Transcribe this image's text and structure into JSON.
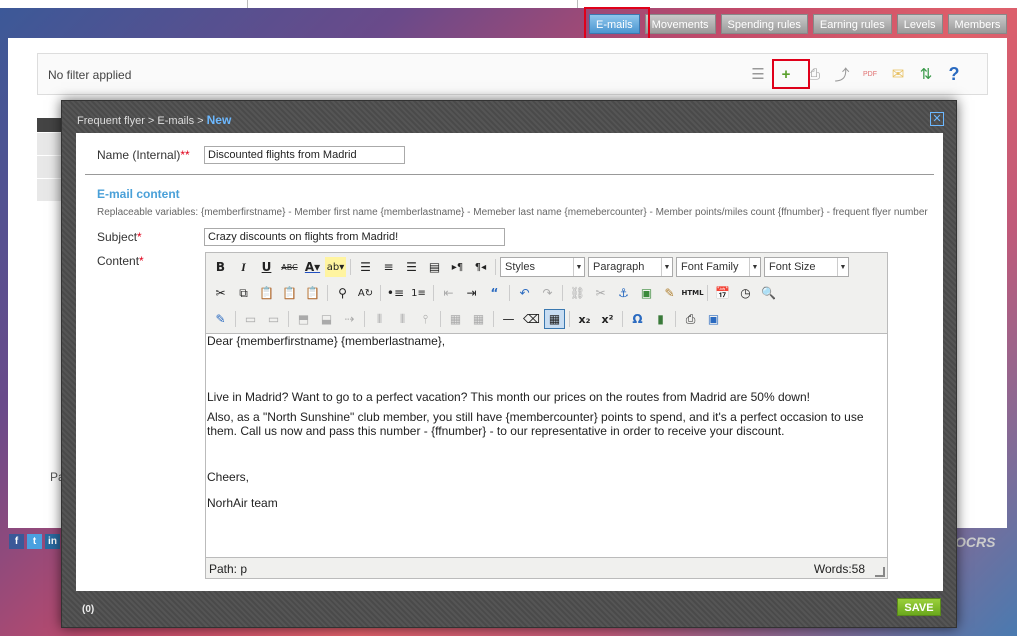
{
  "nav": {
    "tabs": [
      "E-mails",
      "Movements",
      "Spending rules",
      "Earning rules",
      "Levels",
      "Members"
    ],
    "active": "E-mails"
  },
  "page": {
    "filter_text": "No filter applied",
    "bottom_partial": "Pa",
    "footer_logo": "OCRS"
  },
  "toolbar_icons": [
    "search-list-icon",
    "add-new-icon",
    "print-icon",
    "export-icon",
    "pdf-icon",
    "email-icon",
    "refresh-icon",
    "help-icon"
  ],
  "social": [
    "f",
    "t",
    "in"
  ],
  "modal": {
    "breadcrumb_prefix": "Frequent flyer > E-mails > ",
    "breadcrumb_current": "New",
    "close": "✕",
    "count": "(0)",
    "save_label": "SAVE",
    "name_label": "Name (Internal)",
    "name_required": "**",
    "name_value": "Discounted flights from Madrid",
    "section_title": "E-mail content",
    "variables_text": "Replaceable variables: {memberfirstname} - Member first name {memberlastname} - Memeber last name {memebercounter} - Member points/miles count {ffnumber} - frequent flyer number",
    "subject_label": "Subject",
    "subject_required": "*",
    "subject_value": "Crazy discounts on flights from Madrid!",
    "content_label": "Content",
    "content_required": "*"
  },
  "editor": {
    "dropdowns": [
      "Styles",
      "Paragraph",
      "Font Family",
      "Font Size"
    ],
    "body": [
      "Dear {memberfirstname} {memberlastname},",
      "",
      "Live in Madrid? Want to go to a perfect vacation? This month our prices on the routes from Madrid are 50% down!",
      "Also, as a \"North Sunshine\" club member, you still have {membercounter} points to spend, and it's a perfect occasion to use them. Call us now and pass this number - {ffnumber} - to our representative in order to receive your discount.",
      "",
      "Cheers,",
      "NorhAir team"
    ],
    "path": "Path: p",
    "words": "Words:58"
  }
}
